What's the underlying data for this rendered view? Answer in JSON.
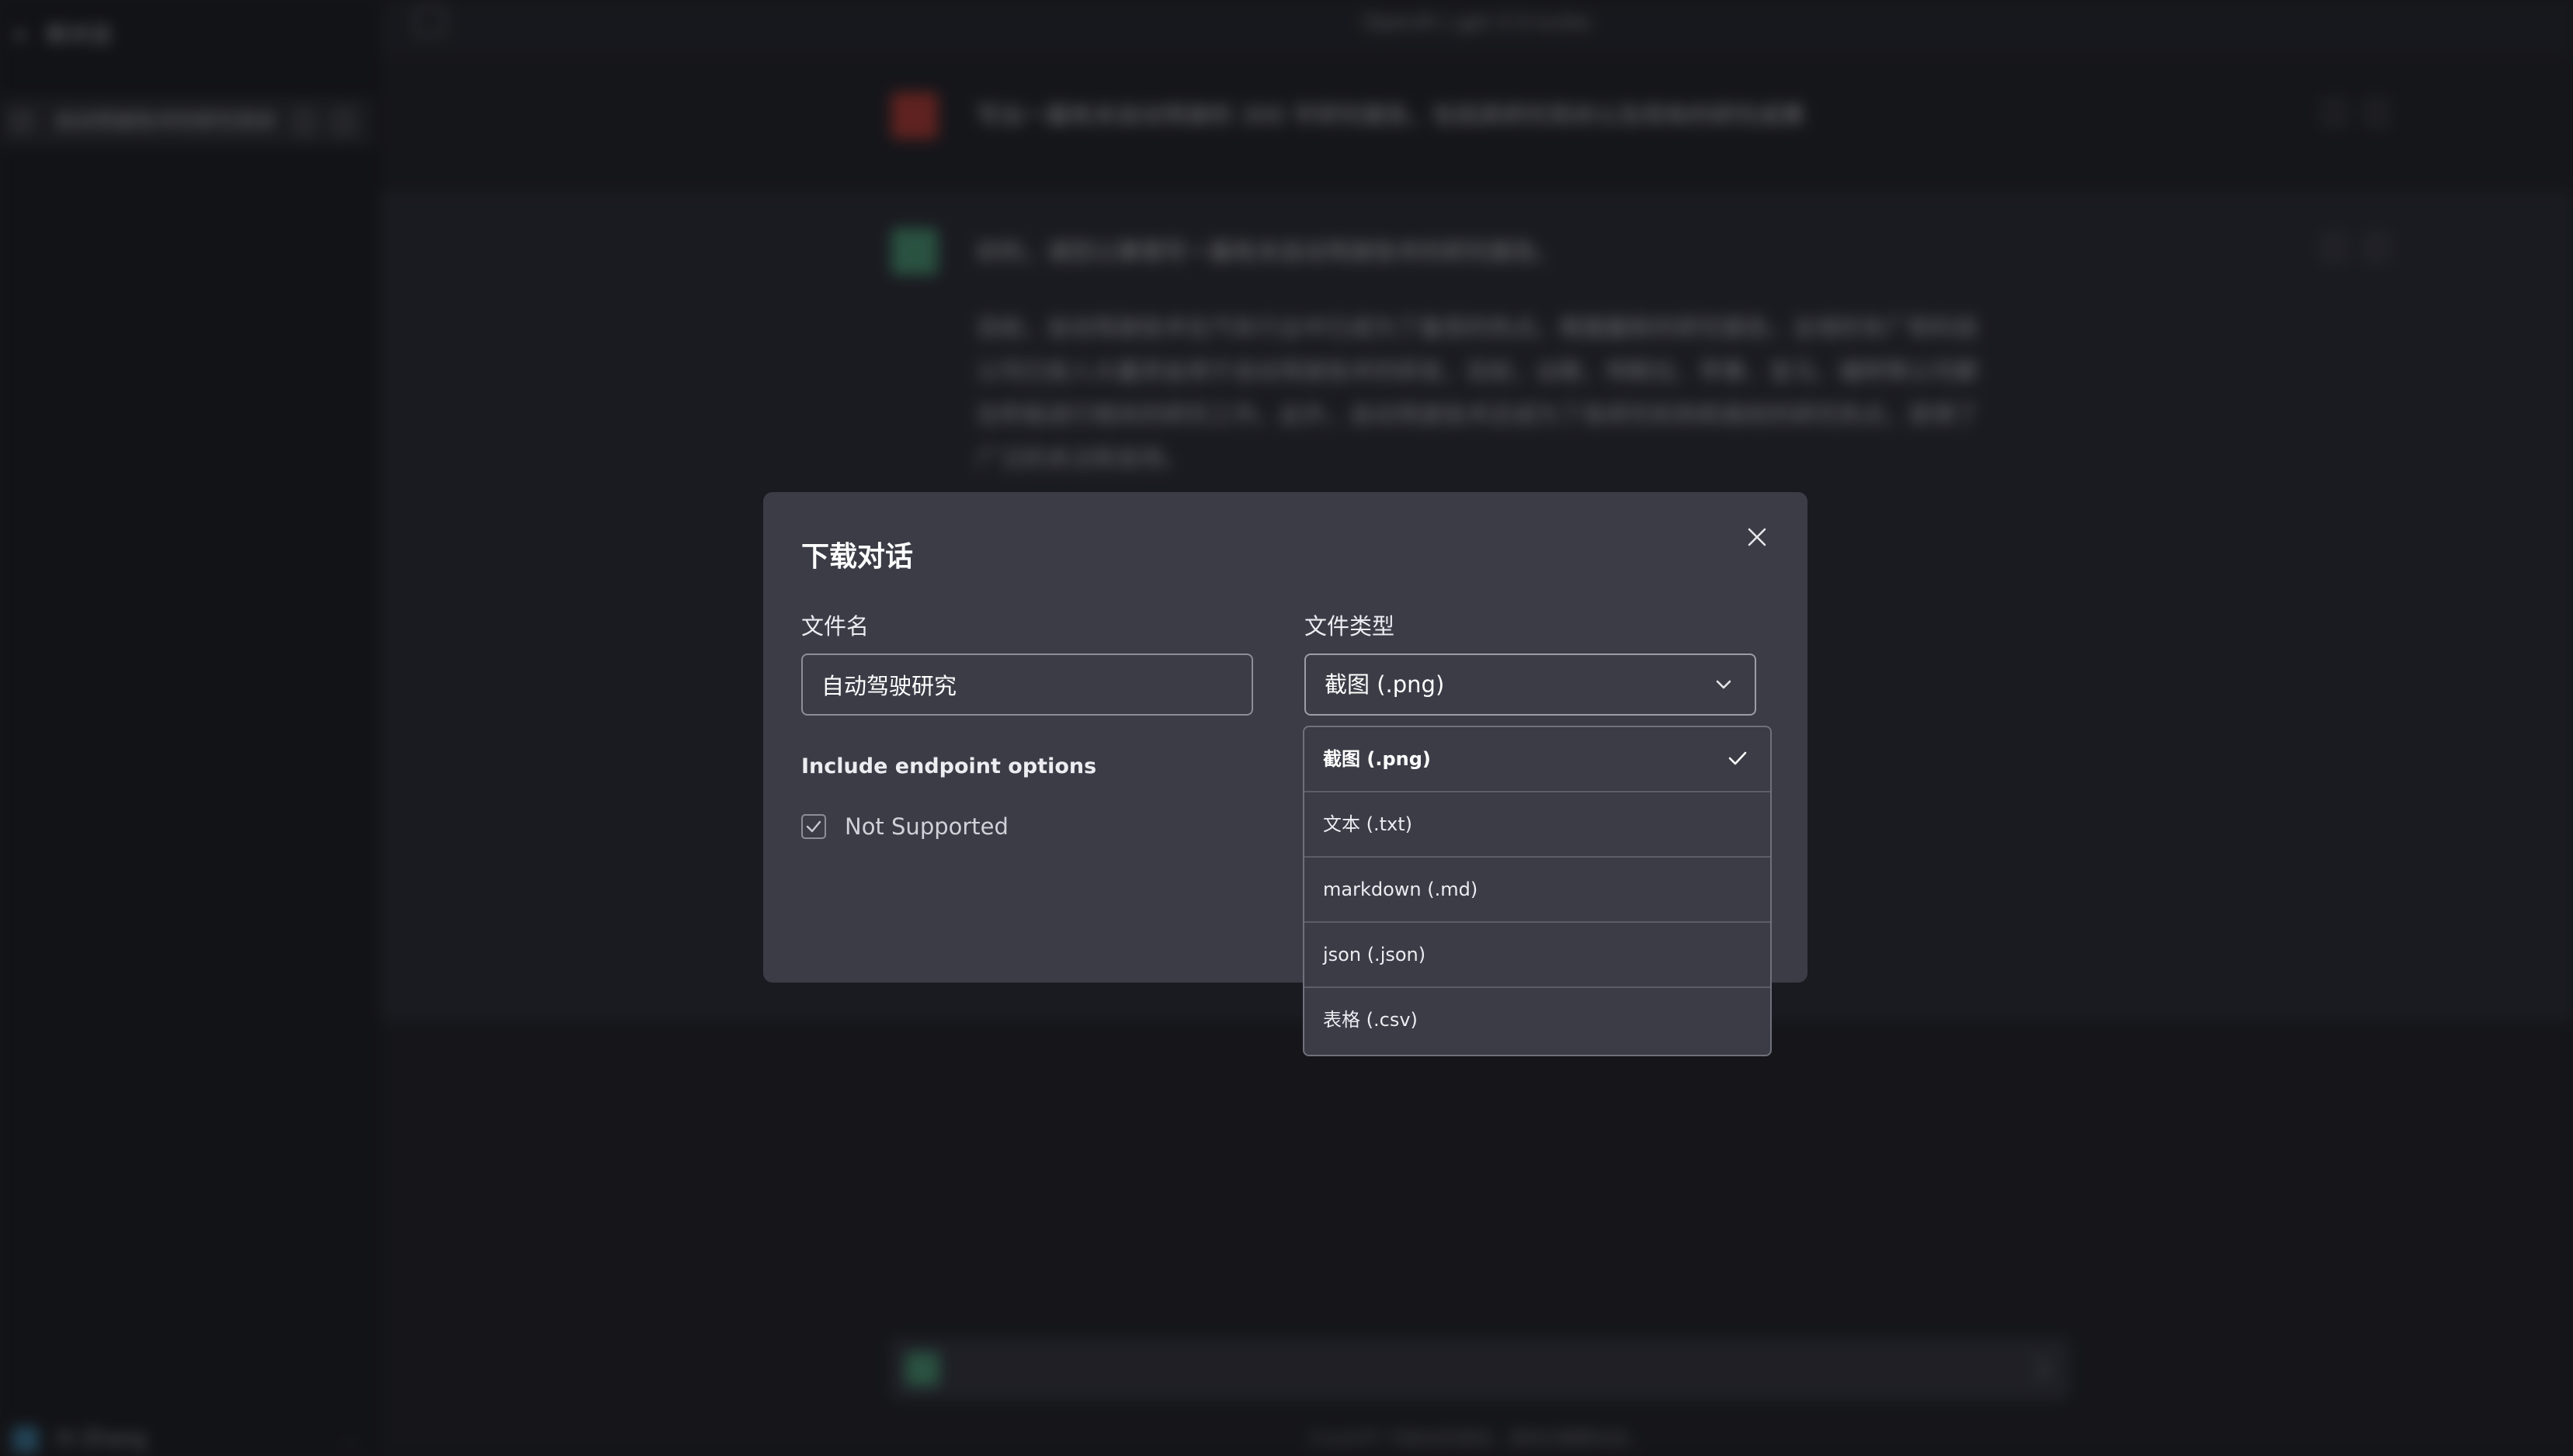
{
  "app": {
    "sidebar": {
      "new_chat": "新对话",
      "conversation": "自动驾驶技术的研究现状",
      "user_name": "Xi Zhang"
    },
    "topbar_title": "OpenAI | gpt-3.5-turbo",
    "user_message": "写出一篇有关自动驾驶的 300 字研究报告，包括其研究现状以及现有的研究成果",
    "ai_message_first": "好的，请您以事情写一篇有关自动驾驶技术的研究报告。",
    "ai_message_para": "目前，自动驾驶技术在汽车行业中已成为了备受的热点。根据最新的研究报告，全球的车厂和科技公司已投入大量资金用于自动驾驶技术的研发，目前，谷歌、特斯拉、苹果、宝马、福特等公司都在积极进行相关的研究工作。此外，自动驾驶技术还成为了各研究机构和高校的研究热点，获得了广泛的关注和支持。",
    "footer": "ChatGPT 可能会犯错误，请核实重要信息。"
  },
  "dialog": {
    "title": "下载对话",
    "filename_label": "文件名",
    "filename_value": "自动驾驶研究",
    "filetype_label": "文件类型",
    "filetype_selected": "截图 (.png)",
    "endpoint_label": "Include endpoint options",
    "checkbox_label": "Not Supported",
    "checkbox_checked": true
  },
  "dropdown": {
    "options": [
      {
        "label": "截图 (.png)",
        "selected": true
      },
      {
        "label": "文本 (.txt)",
        "selected": false
      },
      {
        "label": "markdown (.md)",
        "selected": false
      },
      {
        "label": "json (.json)",
        "selected": false
      },
      {
        "label": "表格 (.csv)",
        "selected": false
      }
    ]
  },
  "colors": {
    "dialog_bg": "#3b3c46",
    "overlay": "#0a0a0e",
    "text": "#ececf1"
  }
}
